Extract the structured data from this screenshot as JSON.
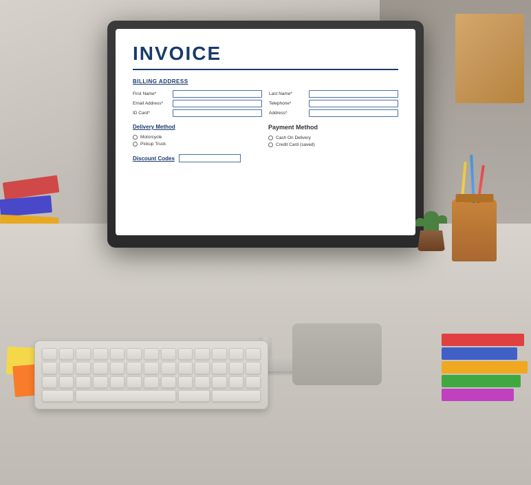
{
  "background": {
    "desk_color": "#c8c5be",
    "surface_color": "#d0ccc5"
  },
  "monitor": {
    "frame_color": "#2e2e2e",
    "screen_bg": "#ffffff"
  },
  "invoice": {
    "title": "INVOICE",
    "billing_section": {
      "label": "BILLING ADDRESS",
      "fields": [
        {
          "label": "First Name*",
          "placeholder": ""
        },
        {
          "label": "Last Name*",
          "placeholder": ""
        },
        {
          "label": "Email Address*",
          "placeholder": ""
        },
        {
          "label": "Telephone*",
          "placeholder": ""
        },
        {
          "label": "ID Card*",
          "placeholder": ""
        },
        {
          "label": "Address*",
          "placeholder": ""
        }
      ]
    },
    "delivery_section": {
      "label": "Delivery Method",
      "options": [
        "Motorcycle",
        "Pickup Truck"
      ]
    },
    "payment_section": {
      "label": "Payment Method",
      "options": [
        "Cash On Delivery",
        "Credit Card (saved)"
      ]
    },
    "discount_section": {
      "label": "Discount Codes"
    }
  },
  "desk_items": {
    "pencil_holder_color": "#b87030",
    "plant_color": "#4a8040",
    "box_color": "#d4a96a",
    "book_colors": [
      "#e84040",
      "#4040d0",
      "#f0a020",
      "#40a040",
      "#e040e0"
    ]
  },
  "keyboard": {
    "color": "#e0ddd8"
  }
}
